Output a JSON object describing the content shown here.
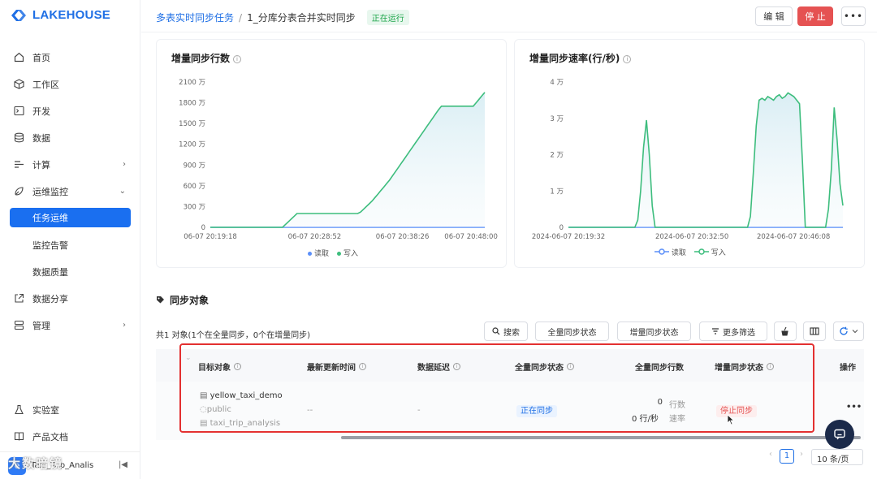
{
  "brand": {
    "name": "LAKEHOUSE",
    "color": "#1f6fe5"
  },
  "sidebar": {
    "items": [
      {
        "label": "首页",
        "icon": "home-icon"
      },
      {
        "label": "工作区",
        "icon": "cube-icon"
      },
      {
        "label": "开发",
        "icon": "terminal-icon"
      },
      {
        "label": "数据",
        "icon": "database-icon"
      },
      {
        "label": "计算",
        "icon": "compute-icon",
        "chevron": "›"
      },
      {
        "label": "运维监控",
        "icon": "monitor-icon",
        "chevron": "⌄"
      }
    ],
    "sub_items": [
      {
        "label": "任务运维",
        "active": true
      },
      {
        "label": "监控告警"
      },
      {
        "label": "数据质量"
      }
    ],
    "items2": [
      {
        "label": "数据分享",
        "icon": "share-icon"
      },
      {
        "label": "管理",
        "icon": "manage-icon",
        "chevron": "›"
      }
    ],
    "bottom": [
      {
        "label": "实验室",
        "icon": "flask-icon"
      },
      {
        "label": "产品文档",
        "icon": "book-icon"
      }
    ],
    "user": {
      "name": "Taxi_Trip_Analis",
      "initial": "e",
      "collapse": "|◀"
    }
  },
  "header": {
    "breadcrumb_parent": "多表实时同步任务",
    "separator": "/",
    "task_name": "1_分库分表合并实时同步",
    "status": "正在运行",
    "edit_label": "编 辑",
    "stop_label": "停 止",
    "more_label": "•••"
  },
  "chart_data": [
    {
      "type": "line",
      "title": "增量同步行数",
      "y_ticks": [
        "2100 万",
        "1800 万",
        "1500 万",
        "1200 万",
        "900 万",
        "600 万",
        "300 万",
        "0"
      ],
      "x_ticks": [
        "06-07 20:19:18",
        "06-07 20:28:52",
        "06-07 20:38:26",
        "06-07 20:48:00"
      ],
      "ylim": [
        0,
        2100
      ],
      "series": [
        {
          "name": "读取",
          "color": "#5b8ff9",
          "values": [
            0,
            0,
            0,
            0,
            0,
            0,
            0,
            0,
            0,
            0,
            0,
            0,
            0,
            0,
            0,
            0,
            0,
            0,
            0,
            0,
            0,
            0,
            0,
            0,
            0,
            0,
            0,
            0,
            0,
            0,
            0,
            0,
            0,
            0,
            0,
            0,
            0,
            0,
            0,
            0,
            0,
            0,
            0,
            0,
            0,
            0,
            0,
            0,
            0,
            0,
            0,
            0,
            0,
            0,
            0,
            0,
            0,
            0,
            0,
            0,
            0,
            0,
            0,
            0,
            0,
            0,
            0,
            0,
            0,
            0,
            0,
            0,
            0,
            0,
            0,
            0,
            0,
            0,
            0,
            0,
            0,
            0,
            0,
            0,
            0,
            0,
            0,
            0,
            0,
            0,
            0,
            0,
            0,
            0,
            0,
            0
          ]
        },
        {
          "name": "写入",
          "color": "#3dbd7d",
          "values": [
            0,
            0,
            0,
            0,
            0,
            0,
            0,
            0,
            0,
            0,
            0,
            0,
            0,
            0,
            0,
            0,
            0,
            0,
            0,
            0,
            0,
            0,
            0,
            0,
            0,
            0,
            40,
            80,
            120,
            160,
            200,
            200,
            200,
            200,
            200,
            200,
            200,
            200,
            200,
            200,
            200,
            200,
            200,
            200,
            200,
            200,
            200,
            200,
            200,
            200,
            200,
            200,
            220,
            260,
            300,
            340,
            380,
            430,
            480,
            530,
            580,
            630,
            680,
            740,
            800,
            860,
            920,
            980,
            1040,
            1100,
            1160,
            1220,
            1280,
            1340,
            1400,
            1460,
            1520,
            1580,
            1640,
            1700,
            1750,
            1750,
            1750,
            1750,
            1750,
            1750,
            1750,
            1750,
            1750,
            1750,
            1750,
            1750,
            1800,
            1850,
            1900,
            1950
          ]
        }
      ]
    },
    {
      "type": "line",
      "title": "增量同步速率(行/秒)",
      "y_ticks": [
        "4 万",
        "3 万",
        "2 万",
        "1 万",
        "0"
      ],
      "x_ticks": [
        "2024-06-07 20:19:32",
        "2024-06-07 20:32:50",
        "2024-06-07 20:46:08"
      ],
      "ylim": [
        0,
        4
      ],
      "series": [
        {
          "name": "读取",
          "color": "#5b8ff9",
          "values": [
            0,
            0,
            0,
            0,
            0,
            0,
            0,
            0,
            0,
            0,
            0,
            0,
            0,
            0,
            0,
            0,
            0,
            0,
            0,
            0,
            0,
            0,
            0,
            0,
            0,
            0,
            0,
            0,
            0,
            0,
            0,
            0,
            0,
            0,
            0,
            0,
            0,
            0,
            0,
            0,
            0,
            0,
            0,
            0,
            0,
            0,
            0,
            0,
            0,
            0,
            0,
            0,
            0,
            0,
            0,
            0,
            0,
            0,
            0,
            0,
            0,
            0,
            0,
            0,
            0,
            0,
            0,
            0,
            0,
            0,
            0,
            0,
            0,
            0,
            0,
            0,
            0,
            0,
            0,
            0,
            0,
            0,
            0,
            0,
            0,
            0,
            0,
            0,
            0,
            0,
            0,
            0,
            0,
            0,
            0,
            0
          ]
        },
        {
          "name": "写入",
          "color": "#3dbd7d",
          "values": [
            0,
            0,
            0,
            0,
            0,
            0,
            0,
            0,
            0,
            0,
            0,
            0,
            0,
            0,
            0,
            0,
            0,
            0,
            0,
            0,
            0,
            0,
            0,
            0,
            0.2,
            1.0,
            2.2,
            2.95,
            2.0,
            0.6,
            0,
            0,
            0,
            0,
            0,
            0,
            0,
            0,
            0,
            0,
            0,
            0,
            0,
            0,
            0,
            0,
            0,
            0,
            0,
            0,
            0,
            0,
            0,
            0,
            0,
            0,
            0,
            0,
            0,
            0,
            0,
            0,
            0,
            0.3,
            1.5,
            2.8,
            3.5,
            3.55,
            3.5,
            3.6,
            3.55,
            3.5,
            3.6,
            3.65,
            3.55,
            3.6,
            3.7,
            3.65,
            3.6,
            3.5,
            3.4,
            1.8,
            0,
            0,
            0,
            0,
            0,
            0,
            0,
            0,
            0.5,
            1.6,
            3.3,
            2.4,
            1.2,
            0.6
          ]
        }
      ]
    }
  ],
  "objects": {
    "title": "同步对象",
    "summary": "共1 对象(1个在全量同步，0个在增量同步)",
    "toolbar": {
      "search": "搜索",
      "full_status": "全量同步状态",
      "inc_status": "增量同步状态",
      "more_filter": "更多筛选"
    },
    "columns": [
      "目标对象",
      "最新更新时间",
      "数据延迟",
      "全量同步状态",
      "全量同步行数",
      "增量同步状态",
      "操作"
    ],
    "row": {
      "table_name": "yellow_taxi_demo",
      "schema": "public",
      "workspace": "taxi_trip_analysis",
      "updated": "--",
      "delay": "-",
      "full_status": "正在同步",
      "rows_value": "0",
      "rows_unit": "行数",
      "rate_value": "0 行/秒",
      "rate_unit": "速率",
      "inc_status": "停止同步",
      "action": "•••"
    },
    "pager": {
      "prev": "‹",
      "page": "1",
      "next": "›",
      "size": "10 条/页"
    }
  },
  "watermark": "大数暗镜"
}
